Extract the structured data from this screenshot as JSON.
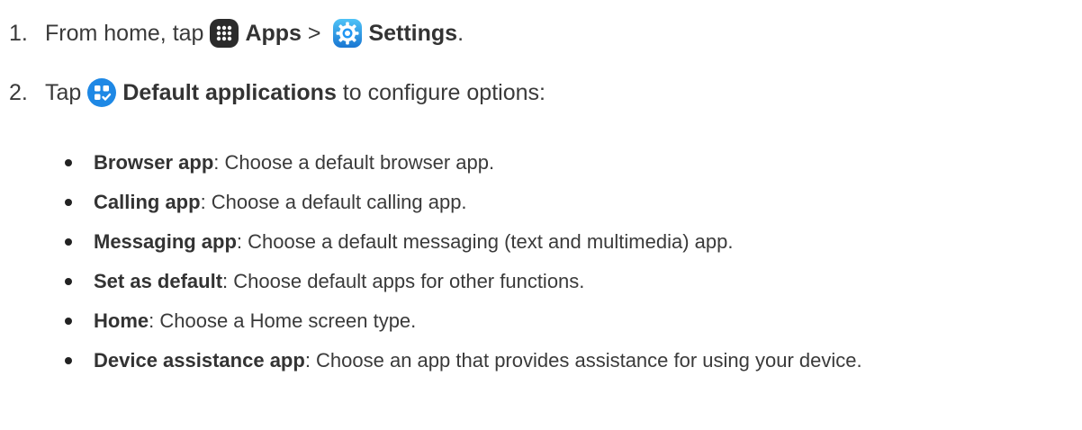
{
  "steps": [
    {
      "number": "1.",
      "prefix": "From home, tap",
      "bold1": "Apps",
      "sep": " > ",
      "bold2": "Settings",
      "suffix": "."
    },
    {
      "number": "2.",
      "prefix": "Tap",
      "bold": "Default applications",
      "suffix": " to configure options:"
    }
  ],
  "options": [
    {
      "term": "Browser app",
      "desc": ": Choose a default browser app."
    },
    {
      "term": "Calling app",
      "desc": ": Choose a default calling app."
    },
    {
      "term": "Messaging app",
      "desc": ": Choose a default messaging (text and multimedia) app."
    },
    {
      "term": "Set as default",
      "desc": ": Choose default apps for other functions."
    },
    {
      "term": "Home",
      "desc": ": Choose a Home screen type."
    },
    {
      "term": "Device assistance app",
      "desc": ": Choose an app that provides assistance for using your device."
    }
  ],
  "icons": {
    "apps": "apps-grid-icon",
    "settings": "settings-gear-icon",
    "default_apps": "default-applications-icon"
  },
  "colors": {
    "apps_icon_bg": "#2b2b2b",
    "settings_icon_bg": "#2196f3",
    "default_apps_icon_bg": "#1e88e5"
  }
}
